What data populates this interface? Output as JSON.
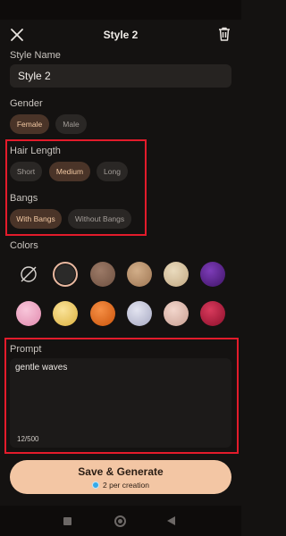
{
  "header": {
    "title": "Style 2"
  },
  "style_name": {
    "label": "Style Name",
    "value": "Style 2"
  },
  "gender": {
    "label": "Gender",
    "options": [
      {
        "label": "Female",
        "selected": true
      },
      {
        "label": "Male",
        "selected": false
      }
    ]
  },
  "hair_length": {
    "label": "Hair Length",
    "options": [
      {
        "label": "Short",
        "selected": false
      },
      {
        "label": "Medium",
        "selected": true
      },
      {
        "label": "Long",
        "selected": false
      }
    ]
  },
  "bangs": {
    "label": "Bangs",
    "options": [
      {
        "label": "With Bangs",
        "selected": true
      },
      {
        "label": "Without Bangs",
        "selected": false
      }
    ]
  },
  "colors": {
    "label": "Colors",
    "swatches": [
      {
        "name": "none",
        "color": "none"
      },
      {
        "name": "black",
        "color": "#2b2a29",
        "selected": true
      },
      {
        "name": "brown",
        "color": "#7a5a48"
      },
      {
        "name": "light-brown",
        "color": "#b18b68"
      },
      {
        "name": "blonde",
        "color": "#d6c2a1"
      },
      {
        "name": "purple",
        "color": "#5a2290"
      },
      {
        "name": "pink",
        "color": "#f0a4c2"
      },
      {
        "name": "gold",
        "color": "#f2cf62"
      },
      {
        "name": "orange",
        "color": "#e96a16"
      },
      {
        "name": "silver",
        "color": "#c7c9dd"
      },
      {
        "name": "rose-blonde",
        "color": "#e2beb4"
      },
      {
        "name": "burgundy",
        "color": "#b3183a"
      }
    ]
  },
  "prompt": {
    "label": "Prompt",
    "value": "gentle waves",
    "counter": "12/500"
  },
  "cta": {
    "label": "Save & Generate",
    "sub": "2 per creation"
  },
  "accent": {
    "selected_chip_bg": "#4a3428",
    "cta_bg": "#f3c6a4",
    "highlight": "#e31b2b"
  }
}
